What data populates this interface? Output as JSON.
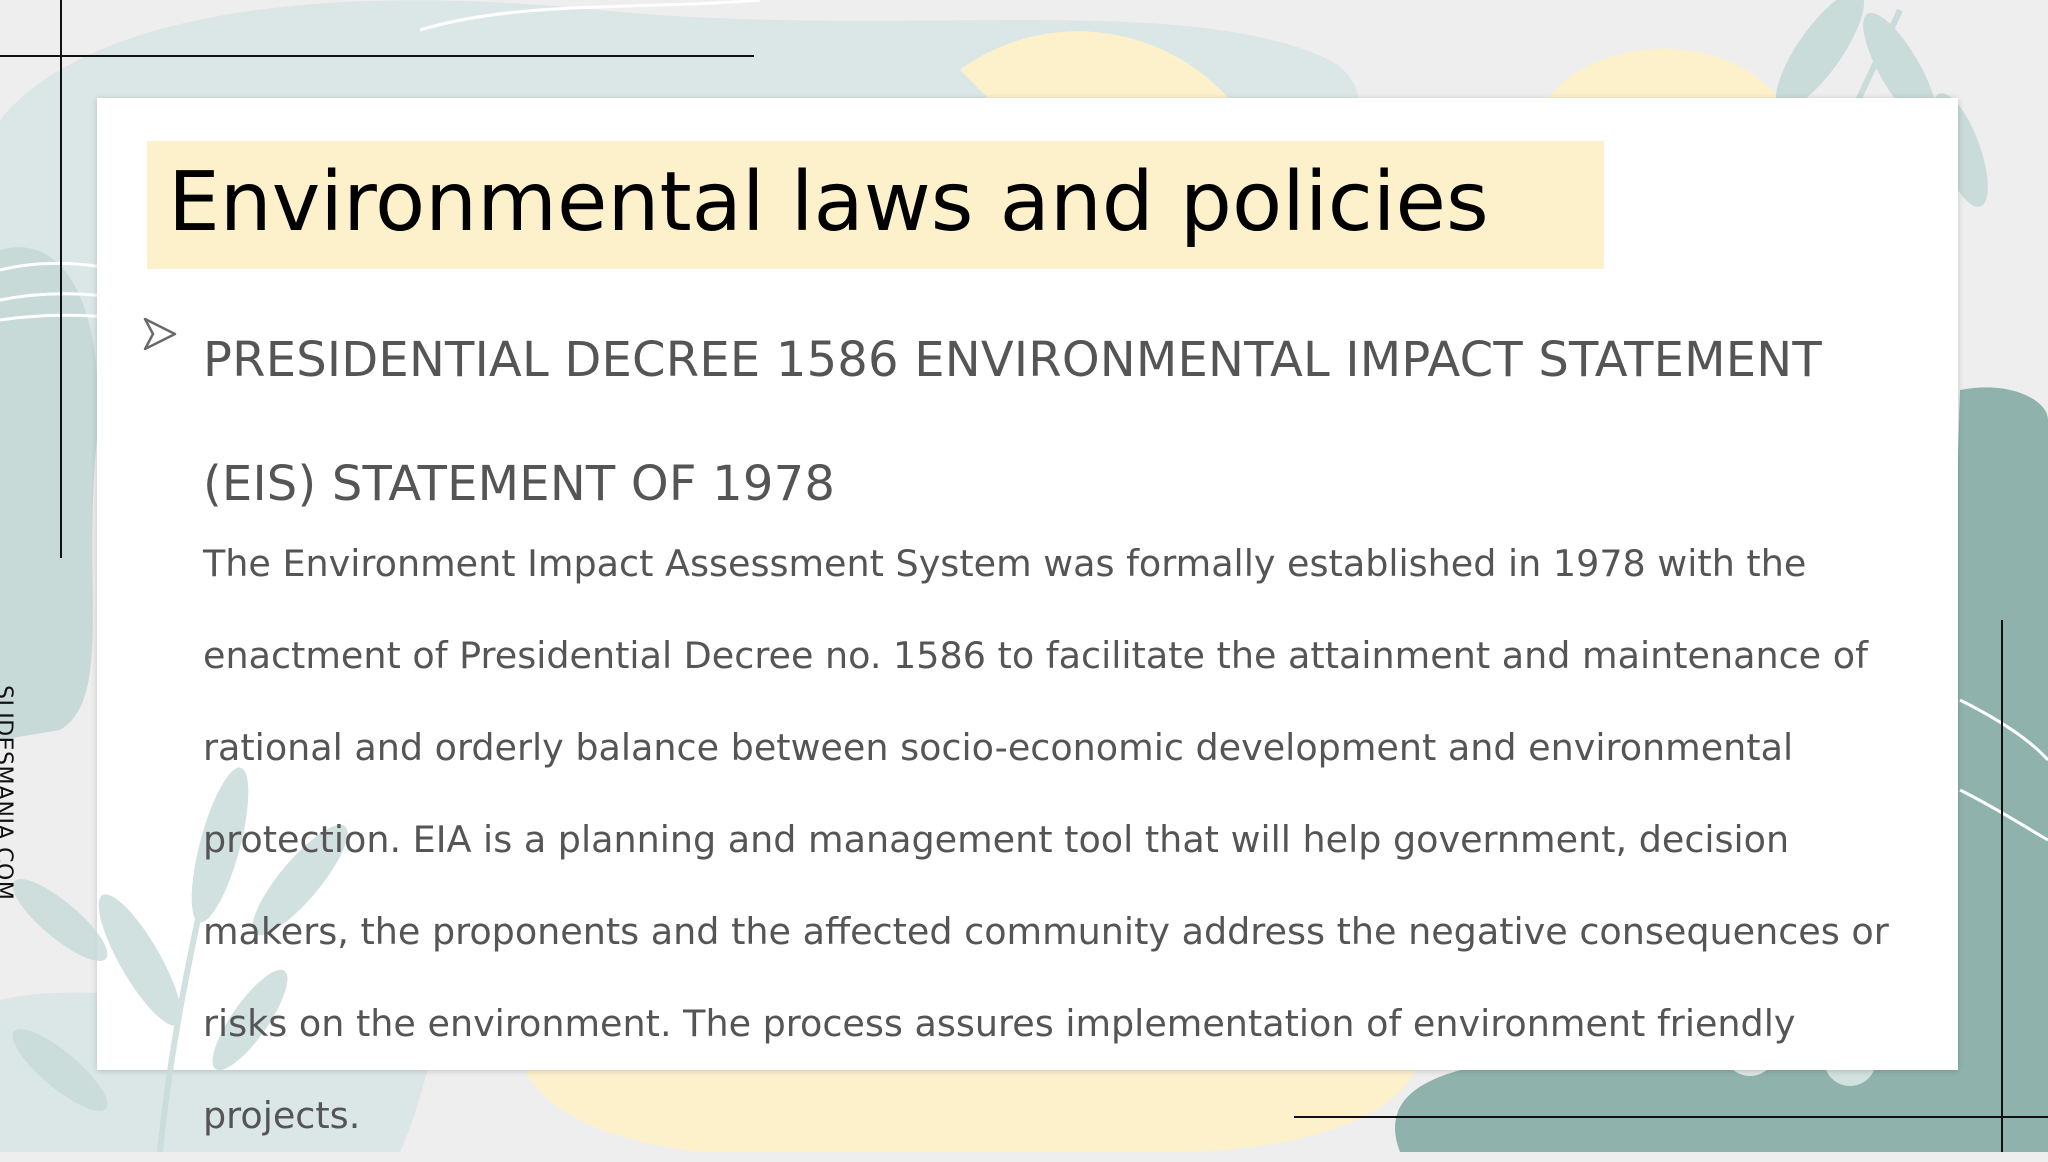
{
  "slide": {
    "title": "Environmental laws and policies",
    "heading": "PRESIDENTIAL DECREE 1586 ENVIRONMENTAL IMPACT STATEMENT (EIS) STATEMENT OF 1978",
    "body": "The Environment Impact Assessment System was formally established in 1978 with the enactment of Presidential Decree no. 1586 to facilitate the attainment and maintenance of rational and orderly balance between socio-economic development and environmental protection. EIA is a planning and management tool that will help government, decision makers, the proponents and the affected community address the negative consequences or risks on the environment. The process assures implementation of environment friendly projects.",
    "watermark": "SLIDESMANIA.COM",
    "bullet_icon": "arrow-bullet-icon"
  },
  "colors": {
    "sage": "#dbe7e6",
    "teal": "#8fb3ac",
    "cream": "#fdf1cc",
    "leaf": "#c9dcda",
    "text": "#555555"
  }
}
